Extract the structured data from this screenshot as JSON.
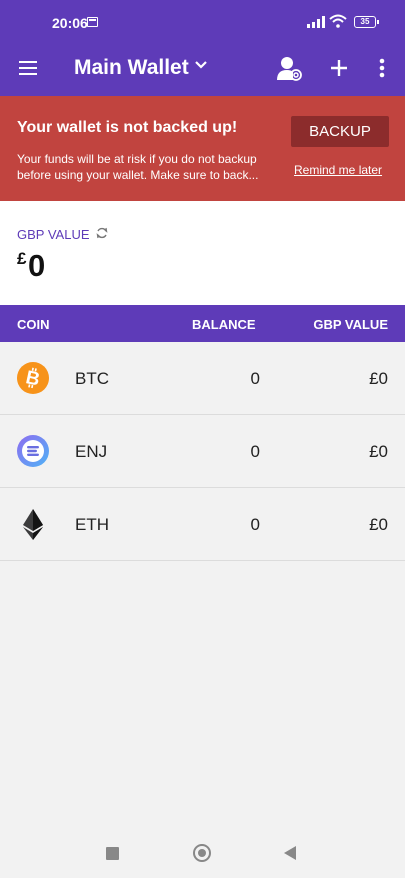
{
  "status": {
    "time": "20:06",
    "battery": "35"
  },
  "appbar": {
    "title": "Main Wallet"
  },
  "banner": {
    "title": "Your wallet is not backed up!",
    "description": "Your funds will be at risk if you do not backup before using your wallet. Make sure to back...",
    "backup_label": "BACKUP",
    "remind_label": "Remind me later"
  },
  "summary": {
    "label": "GBP VALUE",
    "currency_symbol": "£",
    "amount": "0"
  },
  "table": {
    "headers": {
      "coin": "COIN",
      "balance": "BALANCE",
      "value": "GBP VALUE"
    },
    "rows": [
      {
        "symbol": "BTC",
        "balance": "0",
        "value": "£0",
        "icon": "bitcoin-icon",
        "color": "#f7931a"
      },
      {
        "symbol": "ENJ",
        "balance": "0",
        "value": "£0",
        "icon": "enjin-icon",
        "color": "#7866d5"
      },
      {
        "symbol": "ETH",
        "balance": "0",
        "value": "£0",
        "icon": "ethereum-icon",
        "color": "#3c3c3d"
      }
    ]
  },
  "colors": {
    "primary": "#5e3bb8",
    "warning": "#c1443f",
    "warning_button": "#8c2c2c"
  }
}
